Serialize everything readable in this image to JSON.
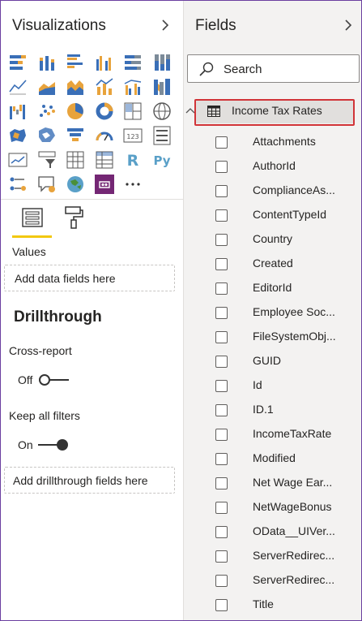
{
  "visualizations": {
    "title": "Visualizations",
    "expand_icon": "chevron-right-icon",
    "icons": [
      [
        "stacked-bar-chart",
        "stacked-column-chart",
        "clustered-bar-chart",
        "clustered-column-chart",
        "100-percent-stacked-bar-chart",
        "100-percent-stacked-column-chart"
      ],
      [
        "line-chart",
        "area-chart",
        "stacked-area-chart",
        "line-and-stacked-column-chart",
        "line-and-clustered-column-chart",
        "ribbon-chart"
      ],
      [
        "waterfall-chart",
        "scatter-chart",
        "pie-chart",
        "donut-chart",
        "treemap",
        "map"
      ],
      [
        "filled-map",
        "shape-map",
        "funnel-chart",
        "gauge",
        "card",
        "multi-row-card"
      ],
      [
        "kpi",
        "slicer",
        "table",
        "matrix",
        "r-script-visual",
        "python-visual"
      ],
      [
        "key-influencers",
        "qna-visual",
        "arcgis-map",
        "power-apps",
        "more-options"
      ]
    ],
    "tabs": {
      "fields_tab": "fields-well-tab",
      "format_tab": "format-paint-roller-tab"
    },
    "values_label": "Values",
    "values_placeholder": "Add data fields here",
    "drillthrough": {
      "heading": "Drillthrough",
      "cross_report_label": "Cross-report",
      "cross_report_state": "Off",
      "keep_filters_label": "Keep all filters",
      "keep_filters_state": "On",
      "placeholder": "Add drillthrough fields here"
    }
  },
  "fields": {
    "title": "Fields",
    "expand_icon": "chevron-right-icon",
    "search_placeholder": "Search",
    "table": {
      "name": "Income Tax Rates",
      "icon": "table-icon",
      "expanded": true
    },
    "items": [
      "Attachments",
      "AuthorId",
      "ComplianceAs...",
      "ContentTypeId",
      "Country",
      "Created",
      "EditorId",
      "Employee Soc...",
      "FileSystemObj...",
      "GUID",
      "Id",
      "ID.1",
      "IncomeTaxRate",
      "Modified",
      "Net Wage Ear...",
      "NetWageBonus",
      "OData__UIVer...",
      "ServerRedirec...",
      "ServerRedirec...",
      "Title"
    ]
  },
  "colors": {
    "accent_yellow": "#f2c811",
    "highlight_red": "#d13438",
    "frame_purple": "#6b3fa0"
  }
}
